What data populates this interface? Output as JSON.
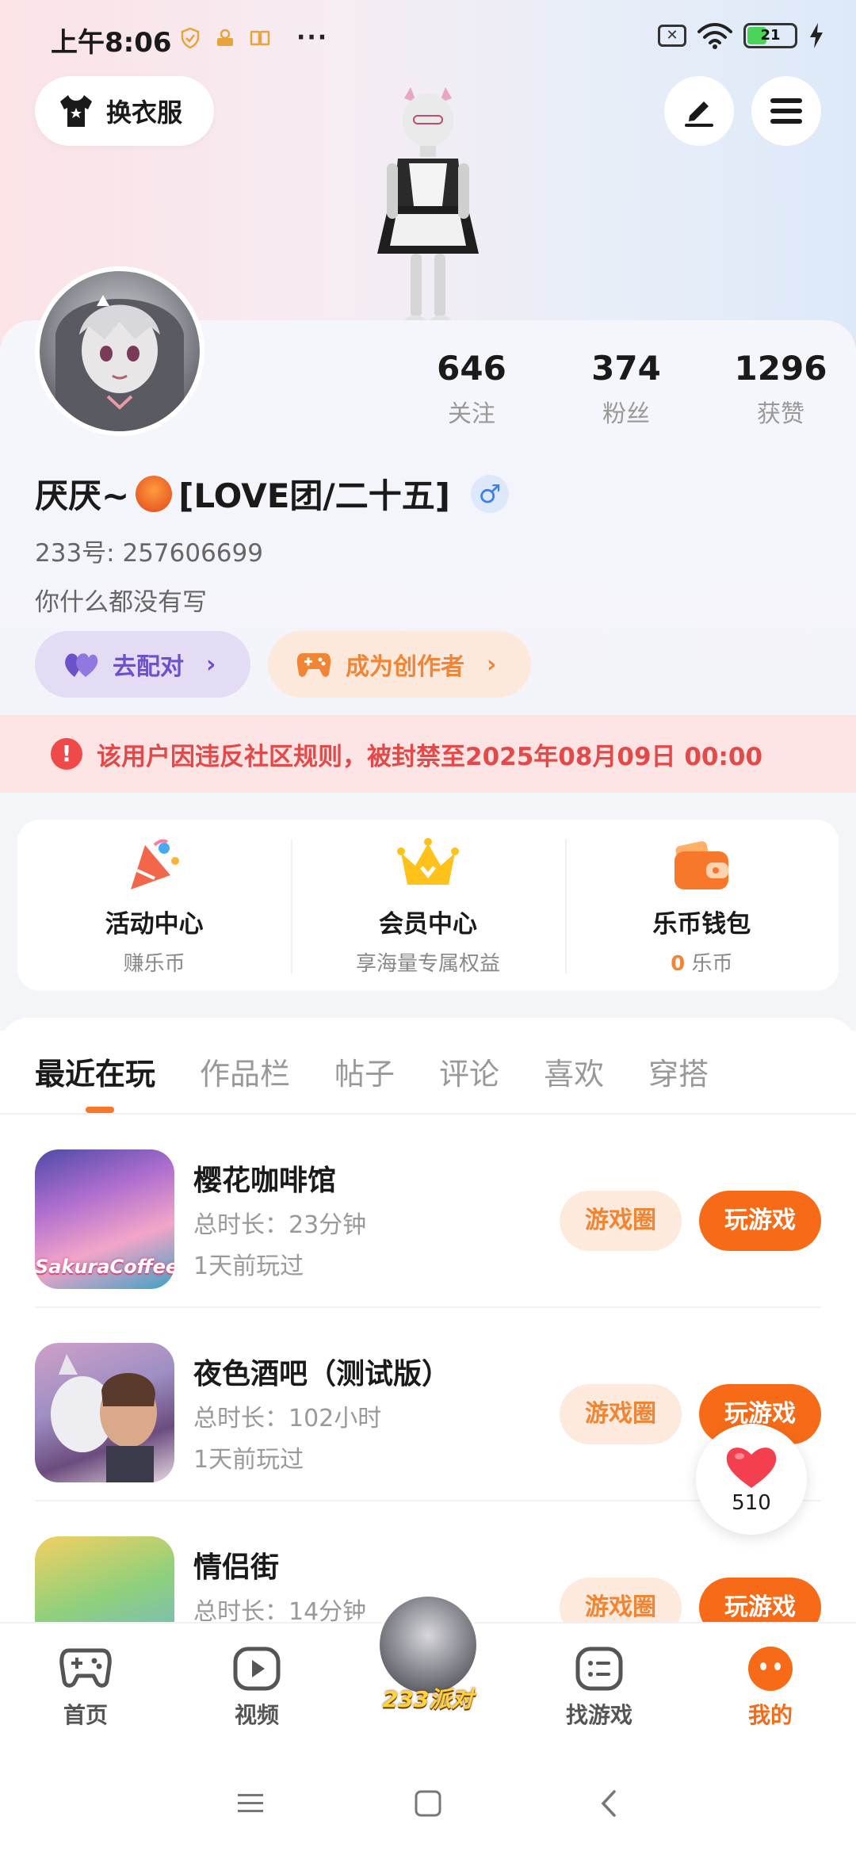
{
  "status_bar": {
    "time": "上午8:06",
    "battery": "21",
    "more": "···"
  },
  "header": {
    "outfit_label": "换衣服"
  },
  "profile": {
    "stats": [
      {
        "value": "646",
        "label": "关注"
      },
      {
        "value": "374",
        "label": "粉丝"
      },
      {
        "value": "1296",
        "label": "获赞"
      }
    ],
    "nickname_prefix": "厌厌~",
    "nickname_suffix": "[LOVE团/二十五]",
    "gender_symbol": "♂",
    "uid": "233号: 257606699",
    "bio": "你什么都没有写",
    "match_label": "去配对",
    "creator_label": "成为创作者"
  },
  "ban_notice": "该用户因违反社区规则，被封禁至2025年08月09日 00:00",
  "services": [
    {
      "title": "活动中心",
      "sub": "赚乐币"
    },
    {
      "title": "会员中心",
      "sub": "享海量专属权益"
    },
    {
      "title": "乐币钱包",
      "sub_num": "0",
      "sub_unit": " 乐币"
    }
  ],
  "tabs": [
    "最近在玩",
    "作品栏",
    "帖子",
    "评论",
    "喜欢",
    "穿搭"
  ],
  "games": [
    {
      "name": "樱花咖啡馆",
      "duration": "总时长：23分钟",
      "last_played": "1天前玩过",
      "thumb_caption": "SakuraCoffee",
      "circle_label": "游戏圈",
      "play_label": "玩游戏"
    },
    {
      "name": "夜色酒吧（测试版）",
      "duration": "总时长：102小时",
      "last_played": "1天前玩过",
      "circle_label": "游戏圈",
      "play_label": "玩游戏"
    },
    {
      "name": "情侣街",
      "duration": "总时长：14分钟",
      "circle_label": "游戏圈",
      "play_label": "玩游戏"
    }
  ],
  "like_float": {
    "count": "510"
  },
  "bottom_nav": {
    "home": "首页",
    "video": "视频",
    "center": "233派对",
    "games": "找游戏",
    "me": "我的"
  },
  "colors": {
    "accent": "#f76b18",
    "ban_text": "#e24a4a",
    "match": "#6c52c8"
  }
}
